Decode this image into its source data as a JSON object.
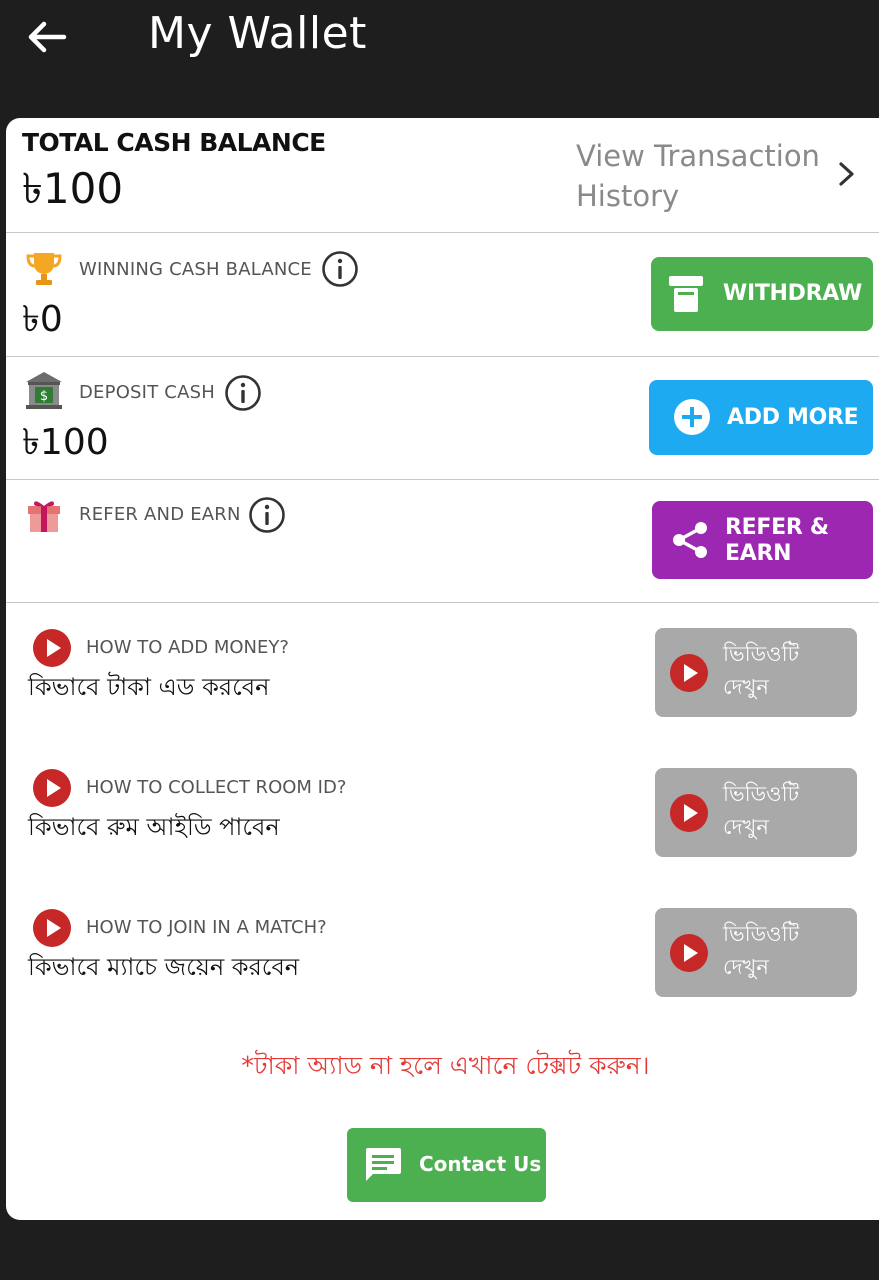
{
  "header": {
    "title": "My Wallet"
  },
  "total": {
    "label": "TOTAL CASH BALANCE",
    "amount": "৳100",
    "history_link": "View Transaction History"
  },
  "winning": {
    "label": "WINNING CASH BALANCE",
    "amount": "৳0",
    "button": "WITHDRAW"
  },
  "deposit": {
    "label": "DEPOSIT CASH",
    "amount": "৳100",
    "button": "ADD MORE"
  },
  "refer": {
    "label": "REFER AND EARN",
    "button_line1": "REFER &",
    "button_line2": "EARN"
  },
  "help_items": [
    {
      "title": "HOW TO ADD MONEY?",
      "subtitle": "কিভাবে টাকা এড করবেন",
      "button": "ভিডিওটি দেখুন"
    },
    {
      "title": "HOW TO COLLECT ROOM ID?",
      "subtitle": "কিভাবে রুম আইডি পাবেন",
      "button": "ভিডিওটি দেখুন"
    },
    {
      "title": "HOW TO JOIN IN A MATCH?",
      "subtitle": "কিভাবে ম্যাচে জয়েন করবেন",
      "button": "ভিডিওটি দেখুন"
    }
  ],
  "notice": "*টাকা অ্যাড না হলে এখানে টেক্সট করুন।",
  "contact_button": "Contact Us",
  "colors": {
    "withdraw": "#4caf50",
    "add_more": "#1eaaf1",
    "refer": "#9c27b0",
    "video_button": "#a9a9a9",
    "youtube_red": "#d32f2f",
    "notice": "#e53935"
  },
  "icons": {
    "back": "arrow-left-icon",
    "winning": "trophy-icon",
    "deposit": "bank-icon",
    "refer": "gift-icon",
    "info": "info-icon",
    "withdraw": "atm-icon",
    "add": "plus-circle-icon",
    "share": "share-icon",
    "play": "play-icon",
    "contact": "chat-icon"
  }
}
